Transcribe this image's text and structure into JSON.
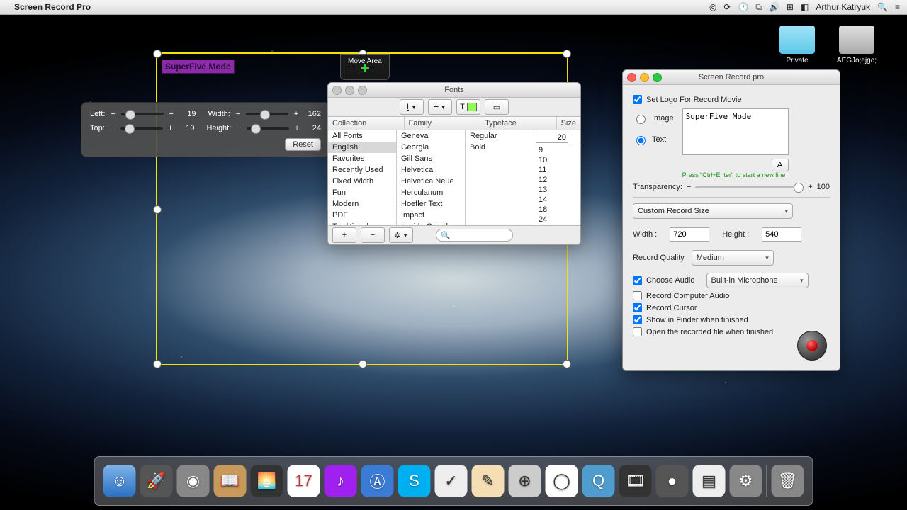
{
  "menubar": {
    "app": "Screen Record Pro",
    "user": "Arthur Katryuk"
  },
  "desktop": {
    "icon1": "Private",
    "icon2": "AEGJo;ejgo;"
  },
  "overlay_text": "SuperFive Mode",
  "move_area": "Move Area",
  "pos": {
    "left_label": "Left:",
    "left_val": "19",
    "top_label": "Top:",
    "top_val": "19",
    "width_label": "Width:",
    "width_val": "162",
    "height_label": "Height:",
    "height_val": "24",
    "reset": "Reset"
  },
  "fonts": {
    "title": "Fonts",
    "col_collection": "Collection",
    "col_family": "Family",
    "col_typeface": "Typeface",
    "col_size": "Size",
    "collections": [
      "All Fonts",
      "English",
      "Favorites",
      "Recently Used",
      "Fixed Width",
      "Fun",
      "Modern",
      "PDF",
      "Traditional"
    ],
    "collections_sel": 1,
    "families": [
      "Geneva",
      "Georgia",
      "Gill Sans",
      "Helvetica",
      "Helvetica Neue",
      "Herculanum",
      "Hoefler Text",
      "Impact",
      "Lucida Grande"
    ],
    "typefaces": [
      "Regular",
      "Bold"
    ],
    "size_value": "20",
    "sizes": [
      "9",
      "10",
      "11",
      "12",
      "13",
      "14",
      "18",
      "24"
    ]
  },
  "app": {
    "title": "Screen Record pro",
    "set_logo": "Set Logo For Record Movie",
    "image": "Image",
    "text": "Text",
    "text_value": "SuperFive Mode",
    "font_btn": "A",
    "hint": "Press \"Ctrl+Enter\" to start a new line",
    "transparency": "Transparency:",
    "trans_val": "100",
    "size_mode": "Custom Record Size",
    "width_l": "Width :",
    "width_v": "720",
    "height_l": "Height :",
    "height_v": "540",
    "quality_l": "Record Quality",
    "quality_v": "Medium",
    "choose_audio": "Choose Audio",
    "audio_v": "Built-in Microphone",
    "rec_comp_audio": "Record Computer Audio",
    "rec_cursor": "Record Cursor",
    "show_finder": "Show in Finder when finished",
    "open_after": "Open the recorded file when finished"
  }
}
